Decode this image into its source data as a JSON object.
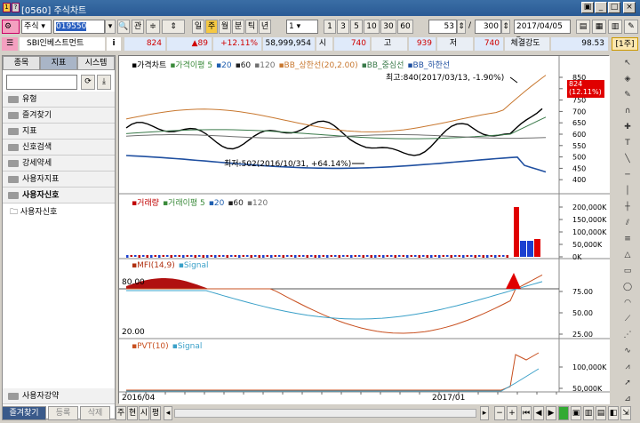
{
  "window": {
    "code": "[0560]",
    "title": "주식차트"
  },
  "toolbar": {
    "market": "주식",
    "stock_code": "019550",
    "gwan": "관",
    "periods": [
      "일",
      "주",
      "월",
      "분",
      "틱",
      "년"
    ],
    "selected_period": "주",
    "interval": "1",
    "intervals": [
      "1",
      "3",
      "5",
      "10",
      "30",
      "60"
    ],
    "count_value": "53",
    "count_total": "300",
    "date": "2017/04/05"
  },
  "quote": {
    "name": "SBI인베스트먼트",
    "info_label": "i",
    "price": "824",
    "change": "▲89",
    "change_pct": "+12.11%",
    "volume": "58,999,954",
    "open_label": "시",
    "open": "740",
    "high_label": "고",
    "high": "939",
    "low_label": "저",
    "low": "740",
    "strength_label": "체결강도",
    "strength": "98.53",
    "unit_btn": "[1주]"
  },
  "left_panel": {
    "tabs": [
      "종목",
      "지표",
      "시스템"
    ],
    "active_tab": "지표",
    "folders": [
      "유형",
      "즐겨찾기",
      "지표",
      "신호검색",
      "강세약세",
      "사용자지표",
      "사용자신호"
    ],
    "sub_item": "사용자신호",
    "bottom_folder": "사용자강약"
  },
  "bottom_bar": {
    "fav": "즐겨찾기",
    "register": "등록",
    "delete": "삭제",
    "tabs": [
      "주",
      "현",
      "시",
      "평"
    ]
  },
  "price_panel": {
    "legend": [
      "가격차트",
      "가격이평 5",
      "20",
      "60",
      "120",
      "BB_상한선(20,2.00)",
      "BB_중심선",
      "BB_하한선"
    ],
    "legend_colors": [
      "#000000",
      "#3a8a3a",
      "#1f5fb0",
      "#202020",
      "#707070",
      "#c87830",
      "#3a7a4a",
      "#1f4fa0"
    ],
    "high_note": "최고:840(2017/03/13, -1.90%)",
    "low_note": "최저:502(2016/10/31, +64.14%)",
    "last_price_box": [
      "824",
      "(12.11%)"
    ],
    "yticks": [
      "850",
      "800",
      "750",
      "700",
      "650",
      "600",
      "550",
      "500",
      "450",
      "400"
    ]
  },
  "volume_panel": {
    "legend": [
      "거래량",
      "거래이평 5",
      "20",
      "60",
      "120"
    ],
    "yticks": [
      "200,000K",
      "150,000K",
      "100,000K",
      "50,000K",
      "0K"
    ]
  },
  "mfi_panel": {
    "legend": [
      "MFI(14,9)",
      "Signal"
    ],
    "level_high": "80.00",
    "level_low": "20.00",
    "yticks": [
      "75.00",
      "50.00",
      "25.00"
    ]
  },
  "pvt_panel": {
    "legend": [
      "PVT(10)",
      "Signal"
    ],
    "yticks": [
      "100,000K",
      "50,000K"
    ]
  },
  "x_axis": {
    "labels": [
      "2016/04",
      "2017/01"
    ]
  },
  "colors": {
    "accent": "#f5c842",
    "up": "#e00000",
    "down": "#1a3fd0"
  }
}
